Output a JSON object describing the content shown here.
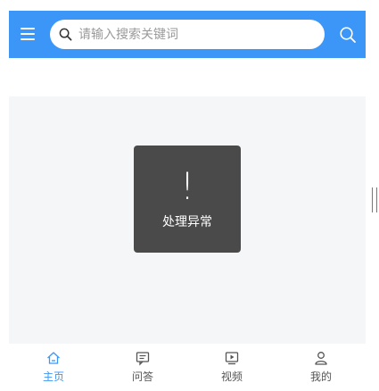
{
  "header": {
    "search_placeholder": "请输入搜索关键词",
    "accent_color": "#3c96f7"
  },
  "toast": {
    "icon": "!",
    "message": "处理异常"
  },
  "tabbar": {
    "items": [
      {
        "label": "主页",
        "icon": "home-icon",
        "active": true
      },
      {
        "label": "问答",
        "icon": "chat-icon",
        "active": false
      },
      {
        "label": "视频",
        "icon": "video-icon",
        "active": false
      },
      {
        "label": "我的",
        "icon": "user-icon",
        "active": false
      }
    ]
  }
}
